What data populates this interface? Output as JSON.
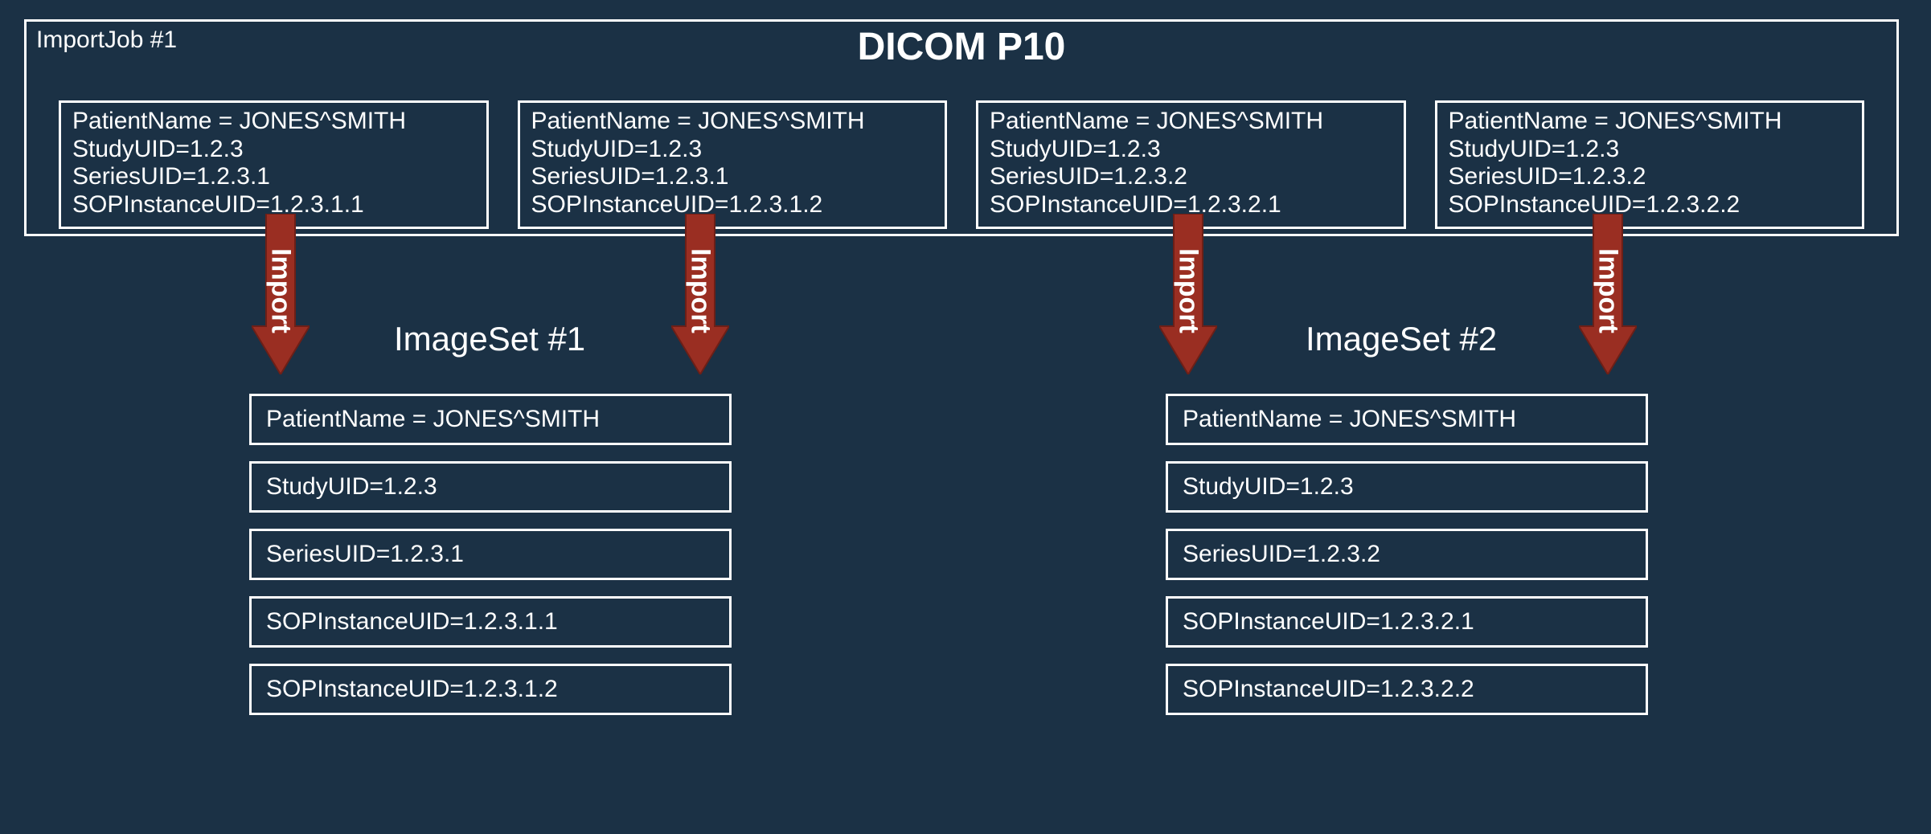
{
  "importJob": {
    "label": "ImportJob #1",
    "title": "DICOM P10",
    "instances": [
      {
        "patient": "PatientName = JONES^SMITH",
        "study": "StudyUID=1.2.3",
        "series": "SeriesUID=1.2.3.1",
        "sop": "SOPInstanceUID=1.2.3.1.1"
      },
      {
        "patient": "PatientName = JONES^SMITH",
        "study": "StudyUID=1.2.3",
        "series": "SeriesUID=1.2.3.1",
        "sop": "SOPInstanceUID=1.2.3.1.2"
      },
      {
        "patient": "PatientName = JONES^SMITH",
        "study": "StudyUID=1.2.3",
        "series": "SeriesUID=1.2.3.2",
        "sop": "SOPInstanceUID=1.2.3.2.1"
      },
      {
        "patient": "PatientName = JONES^SMITH",
        "study": "StudyUID=1.2.3",
        "series": "SeriesUID=1.2.3.2",
        "sop": "SOPInstanceUID=1.2.3.2.2"
      }
    ]
  },
  "arrowLabel": "Import",
  "imageSets": [
    {
      "title": "ImageSet #1",
      "rows": [
        "PatientName = JONES^SMITH",
        "StudyUID=1.2.3",
        "SeriesUID=1.2.3.1",
        "SOPInstanceUID=1.2.3.1.1",
        "SOPInstanceUID=1.2.3.1.2"
      ]
    },
    {
      "title": "ImageSet #2",
      "rows": [
        "PatientName = JONES^SMITH",
        "StudyUID=1.2.3",
        "SeriesUID=1.2.3.2",
        "SOPInstanceUID=1.2.3.2.1",
        "SOPInstanceUID=1.2.3.2.2"
      ]
    }
  ],
  "colors": {
    "arrow": "#9a2e22",
    "arrowStroke": "#6d1f17"
  }
}
